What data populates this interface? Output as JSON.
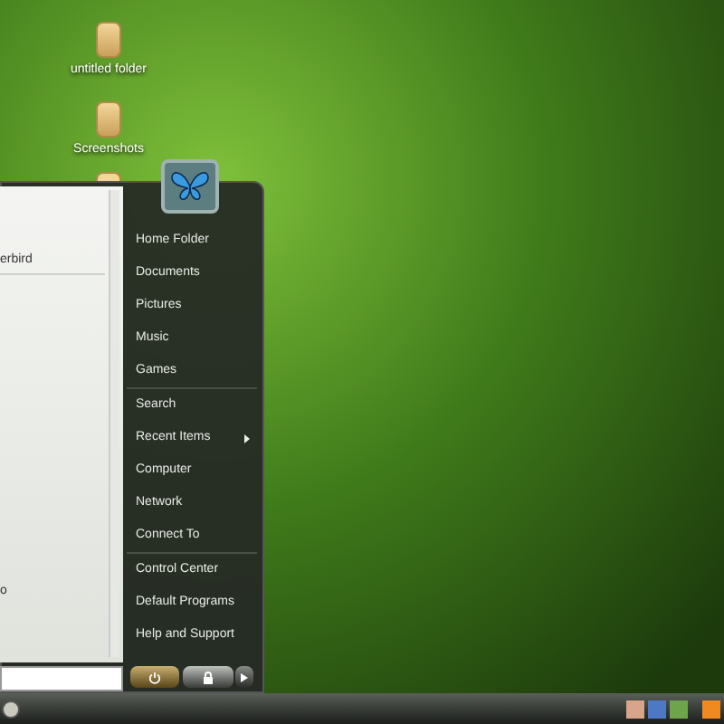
{
  "desktop_icons": [
    {
      "label": "untitled folder",
      "covered": false
    },
    {
      "label": "Screenshots",
      "covered": false
    },
    {
      "covered": true
    }
  ],
  "start_menu": {
    "programs": [
      {
        "label": "erbird"
      },
      {
        "label": "o"
      }
    ],
    "place_groups": [
      {
        "items": [
          {
            "label": "Home Folder",
            "submenu": false
          },
          {
            "label": "Documents",
            "submenu": false
          },
          {
            "label": "Pictures",
            "submenu": false
          },
          {
            "label": "Music",
            "submenu": false
          },
          {
            "label": "Games",
            "submenu": false
          }
        ]
      },
      {
        "items": [
          {
            "label": "Search",
            "submenu": false
          },
          {
            "label": "Recent Items",
            "submenu": true
          },
          {
            "label": "Computer",
            "submenu": false
          },
          {
            "label": "Network",
            "submenu": false
          },
          {
            "label": "Connect To",
            "submenu": false
          }
        ]
      },
      {
        "items": [
          {
            "label": "Control Center",
            "submenu": false
          },
          {
            "label": "Default Programs",
            "submenu": false
          },
          {
            "label": "Help and Support",
            "submenu": false
          }
        ]
      }
    ]
  }
}
